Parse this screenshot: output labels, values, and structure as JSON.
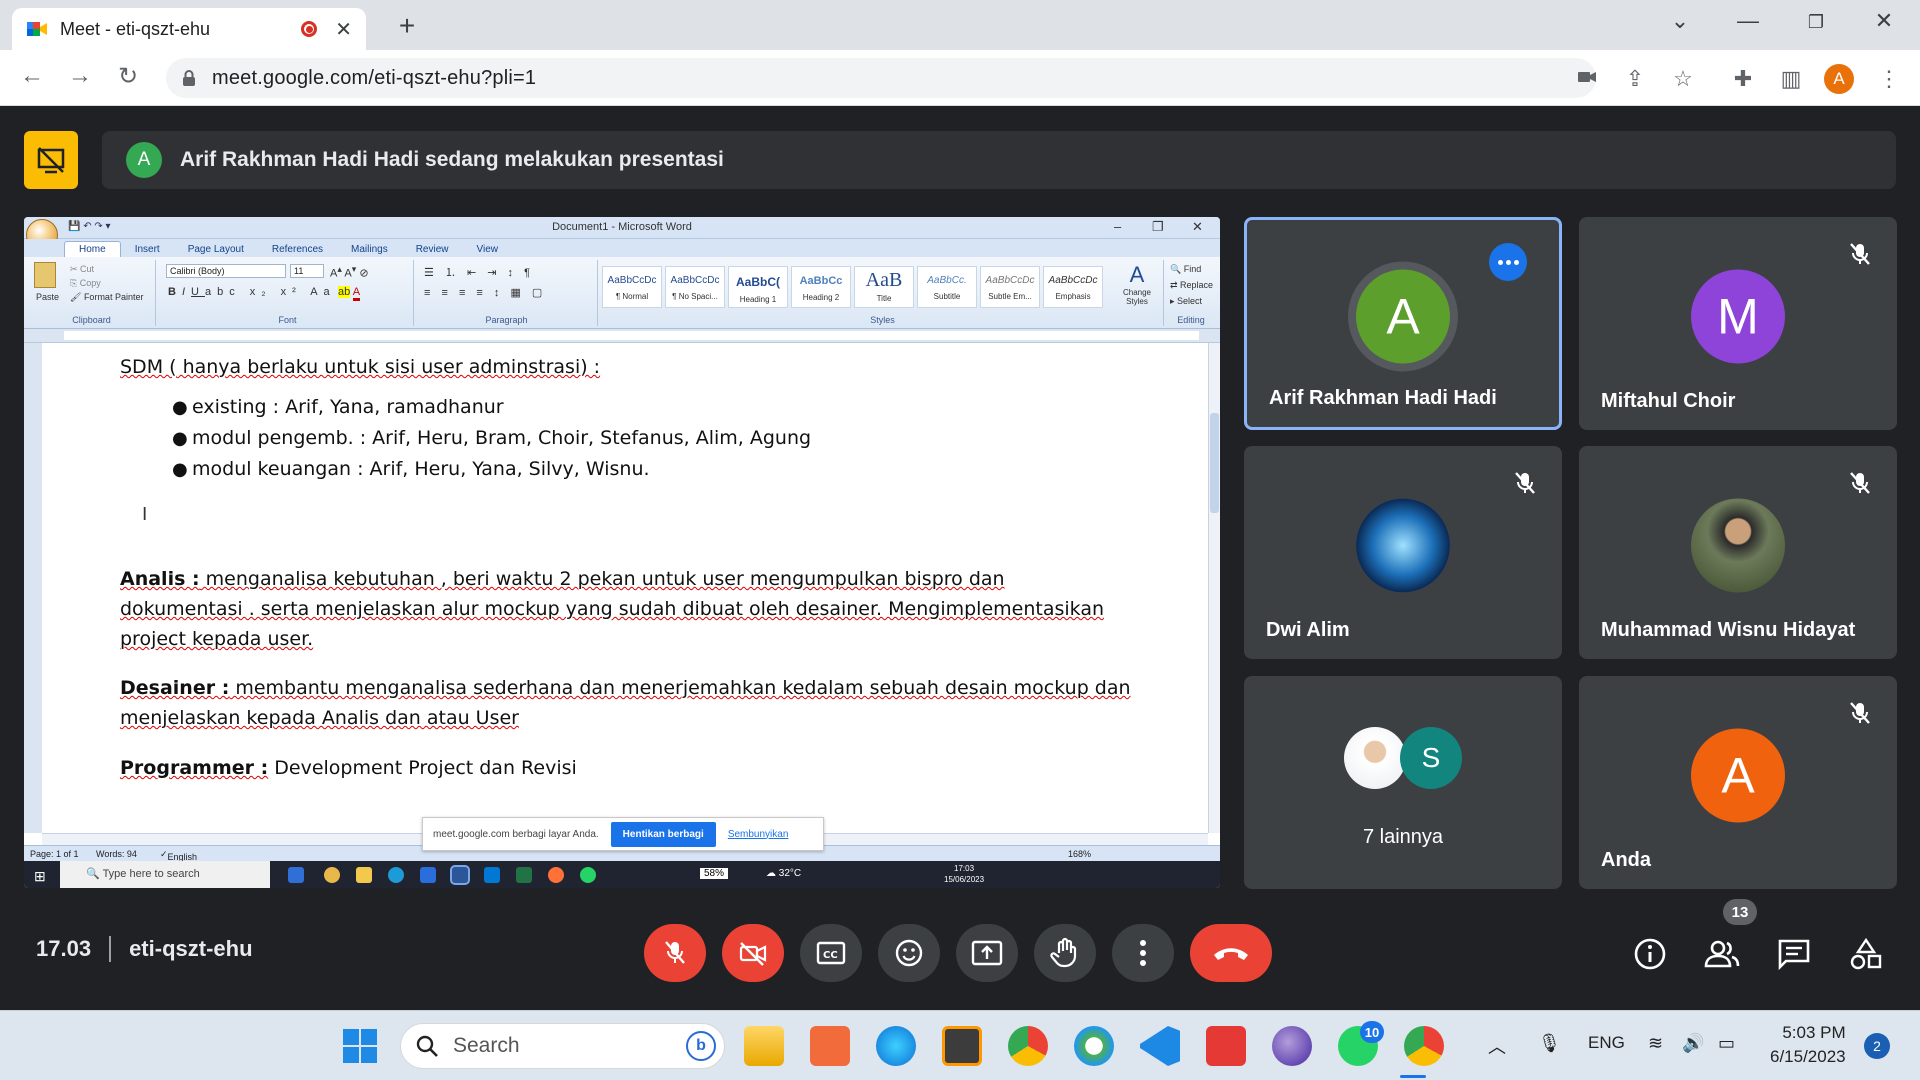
{
  "browser": {
    "tab_title": "Meet - eti-qszt-ehu",
    "url": "meet.google.com/eti-qszt-ehu?pli=1",
    "profile_initial": "A"
  },
  "presentation_banner": {
    "avatar_initial": "A",
    "text": "Arif Rakhman Hadi Hadi sedang melakukan presentasi"
  },
  "word": {
    "window_title": "Document1 - Microsoft Word",
    "tabs": [
      "Home",
      "Insert",
      "Page Layout",
      "References",
      "Mailings",
      "Review",
      "View"
    ],
    "clipboard": {
      "paste": "Paste",
      "cut": "Cut",
      "copy": "Copy",
      "format_painter": "Format Painter",
      "group": "Clipboard"
    },
    "font": {
      "name": "Calibri (Body)",
      "size": "11",
      "group": "Font"
    },
    "paragraph_group": "Paragraph",
    "styles_group": "Styles",
    "styles": [
      {
        "preview": "AaBbCcDc",
        "name": "¶ Normal"
      },
      {
        "preview": "AaBbCcDc",
        "name": "¶ No Spaci..."
      },
      {
        "preview": "AaBbC(",
        "name": "Heading 1"
      },
      {
        "preview": "AaBbCc",
        "name": "Heading 2"
      },
      {
        "preview": "AaB",
        "name": "Title"
      },
      {
        "preview": "AaBbCc.",
        "name": "Subtitle"
      },
      {
        "preview": "AaBbCcDc",
        "name": "Subtle Em..."
      },
      {
        "preview": "AaBbCcDc",
        "name": "Emphasis"
      }
    ],
    "change_styles": "Change Styles",
    "editing": {
      "find": "Find",
      "replace": "Replace",
      "select": "Select",
      "group": "Editing"
    },
    "doc": {
      "sdm_line": "SDM ( hanya berlaku untuk sisi user adminstrasi) :",
      "bullets": [
        "existing : Arif, Yana, ramadhanur",
        "modul pengemb. : Arif, Heru, Bram, Choir, Stefanus, Alim, Agung",
        "modul keuangan : Arif, Heru, Yana, Silvy, Wisnu."
      ],
      "analis_label": "Analis :",
      "analis_text1": " menganalisa kebutuhan , beri waktu 2 pekan untuk user mengumpulkan bispro dan",
      "analis_text2": "dokumentasi . serta menjelaskan alur mockup yang sudah dibuat oleh desainer. Mengimplementasikan",
      "analis_text3": "project kepada user.",
      "desainer_label": "Desainer :",
      "desainer_text1": " membantu menganalisa sederhana dan menerjemahkan kedalam sebuah desain mockup dan",
      "desainer_text2": "menjelaskan kepada Analis dan atau User",
      "programmer_label": "Programmer :",
      "programmer_text": " Development Project dan Revisi"
    },
    "status": {
      "page": "Page: 1 of 1",
      "words": "Words: 94",
      "lang": "English (United States)",
      "zoom": "168%"
    },
    "share_bar": {
      "text": "meet.google.com berbagi layar Anda.",
      "stop": "Hentikan berbagi",
      "hide": "Sembunyikan"
    },
    "inner_taskbar": {
      "search": "Type here to search",
      "battery": "58%",
      "weather": "32°C",
      "time": "17:03",
      "date": "15/06/2023"
    }
  },
  "participants": [
    {
      "name": "Arif Rakhman Hadi Hadi",
      "initial": "A",
      "color": "#5c9f2c"
    },
    {
      "name": "Miftahul Choir",
      "initial": "M",
      "color": "#8e44d8"
    },
    {
      "name": "Dwi Alim",
      "initial": "",
      "color": "#3c4043"
    },
    {
      "name": "Muhammad Wisnu Hidayat",
      "initial": "",
      "color": "#6d7a5a"
    },
    {
      "name": "7 lainnya",
      "initial": "S",
      "color": "#12857e"
    },
    {
      "name": "Anda",
      "initial": "A",
      "color": "#f1620f"
    }
  ],
  "controls": {
    "time": "17.03",
    "meeting_code": "eti-qszt-ehu",
    "participant_count": "13"
  },
  "taskbar": {
    "search_placeholder": "Search",
    "whatsapp_badge": "10",
    "lang": "ENG",
    "time": "5:03 PM",
    "date": "6/15/2023",
    "notifications": "2"
  },
  "colors": {
    "meet_bg": "#202124",
    "tile_bg": "#3c4043",
    "danger": "#ea4335",
    "accent": "#1a73e8"
  }
}
